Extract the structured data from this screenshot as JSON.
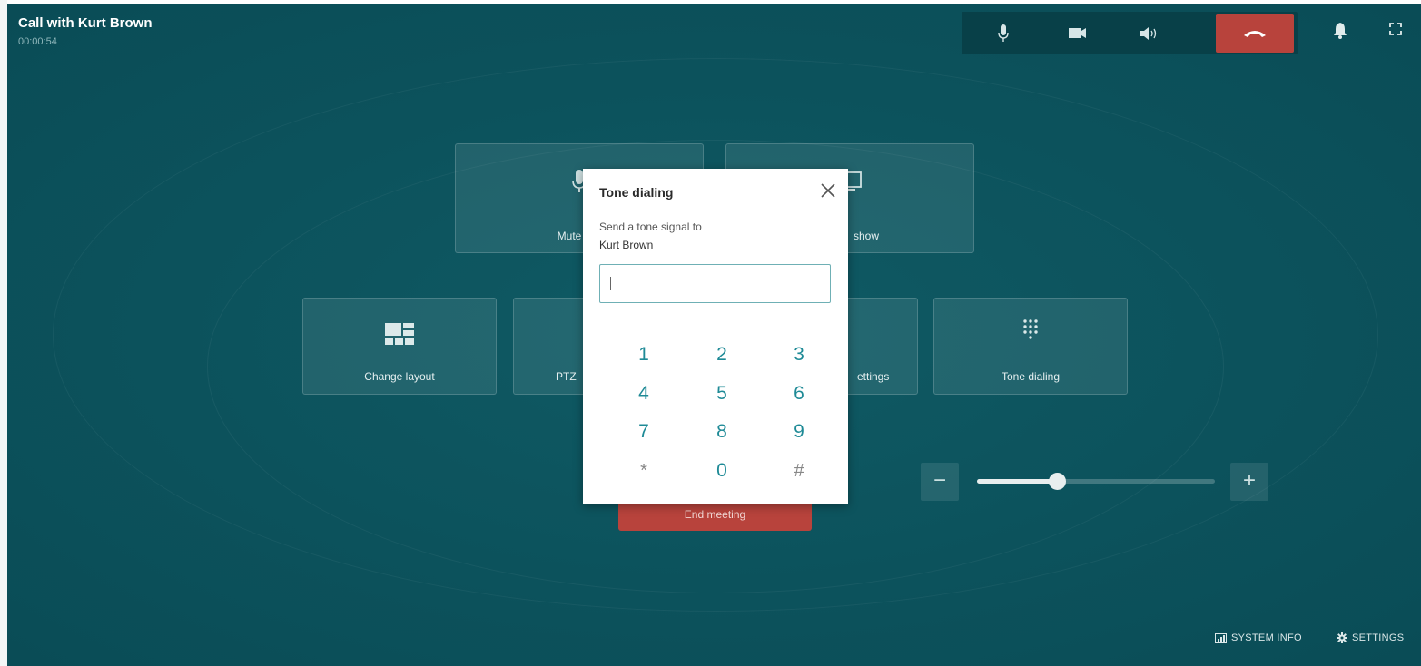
{
  "header": {
    "title": "Call with Kurt Brown",
    "timer": "00:00:54"
  },
  "tiles": {
    "mute_mic": "Mute mic",
    "slideshow": "show",
    "change_layout": "Change layout",
    "ptz": "PTZ",
    "settings": "ettings",
    "tone_dialing": "Tone dialing"
  },
  "end_meeting": "End meeting",
  "volume": {
    "level": 0.34,
    "minus": "−",
    "plus": "+"
  },
  "footer": {
    "system_info": "SYSTEM INFO",
    "settings": "SETTINGS"
  },
  "dialog": {
    "title": "Tone dialing",
    "text1": "Send a tone signal to",
    "text2": "Kurt Brown",
    "input_value": "",
    "keys": [
      "1",
      "2",
      "3",
      "4",
      "5",
      "6",
      "7",
      "8",
      "9",
      "*",
      "0",
      "#"
    ]
  },
  "colors": {
    "background": "#0c525c",
    "hangup": "#b8433c",
    "accent": "#1e8a96"
  }
}
